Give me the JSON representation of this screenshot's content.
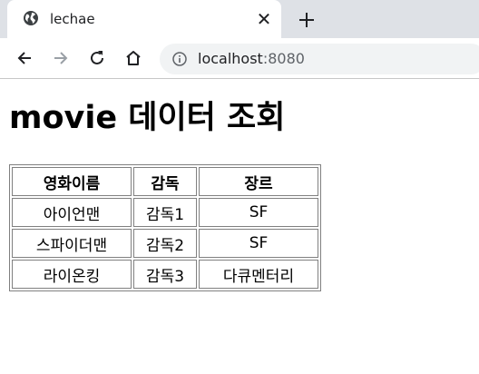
{
  "browser": {
    "tab": {
      "title": "lechae",
      "close_label": "✕"
    },
    "new_tab_label": "+",
    "address": {
      "host": "localhost",
      "port": ":8080"
    }
  },
  "page": {
    "heading": "movie 데이터 조회",
    "table": {
      "headers": [
        "영화이름",
        "감독",
        "장르"
      ],
      "rows": [
        [
          "아이언맨",
          "감독1",
          "SF"
        ],
        [
          "스파이더맨",
          "감독2",
          "SF"
        ],
        [
          "라이온킹",
          "감독3",
          "다큐멘터리"
        ]
      ]
    }
  }
}
